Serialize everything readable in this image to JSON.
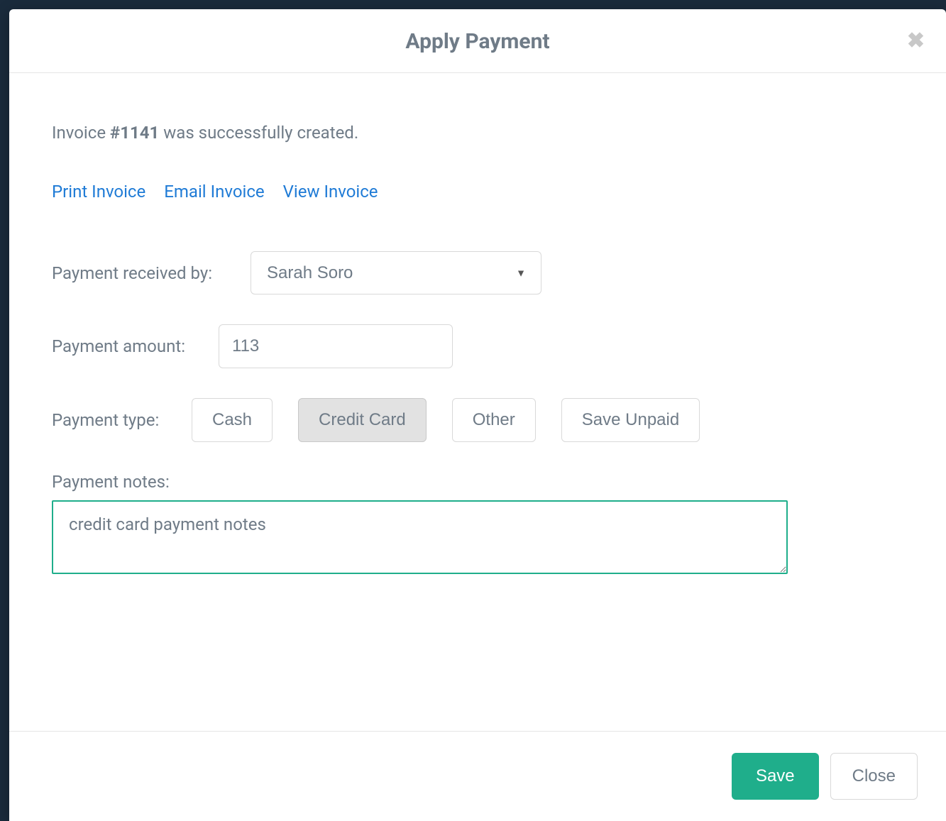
{
  "modal": {
    "title": "Apply Payment",
    "close_icon": "✖"
  },
  "success": {
    "prefix": "Invoice ",
    "invoice_label": "#1141",
    "suffix": " was successfully created."
  },
  "links": {
    "print": "Print Invoice",
    "email": "Email Invoice",
    "view": "View Invoice"
  },
  "form": {
    "received_by_label": "Payment received by:",
    "received_by_value": "Sarah Soro",
    "amount_label": "Payment amount:",
    "amount_value": "113",
    "type_label": "Payment type:",
    "types": {
      "cash": "Cash",
      "credit_card": "Credit Card",
      "other": "Other",
      "save_unpaid": "Save Unpaid"
    },
    "notes_label": "Payment notes:",
    "notes_value": "credit card payment notes"
  },
  "footer": {
    "save": "Save",
    "close": "Close"
  }
}
